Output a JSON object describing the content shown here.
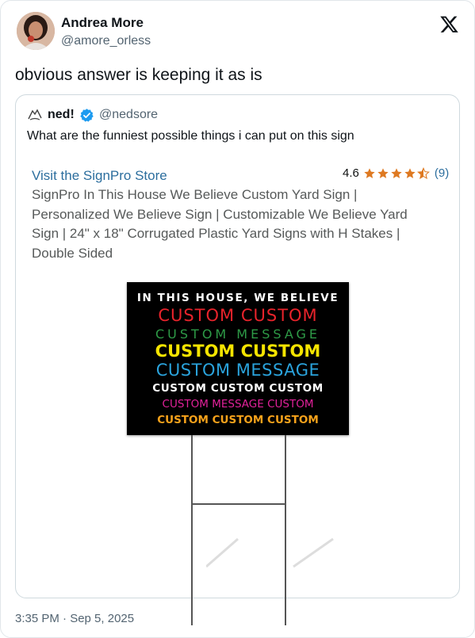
{
  "author": {
    "name": "Andrea More",
    "handle": "@amore_orless",
    "avatar_icon": "avatar-photo"
  },
  "platform_icon": "x-logo-icon",
  "tweet": {
    "text": "obvious answer is keeping it as is",
    "timestamp": "3:35 PM · Sep 5, 2025"
  },
  "quote": {
    "author_icon": "hands-icon",
    "name": "ned!",
    "verified_icon": "verified-badge-icon",
    "handle": "@nedsore",
    "text": "What are the funniest possible things i can put on this sign",
    "product": {
      "store_link": "Visit the SignPro Store",
      "rating": "4.6",
      "rating_stars": 4.6,
      "rating_count": "(9)",
      "title_lines": [
        "SignPro In This House We Believe Custom Yard Sign |",
        "Personalized We Believe Sign | Customizable We Believe Yard",
        "Sign | 24\" x 18\" Corrugated Plastic Yard Signs with H Stakes |",
        "Double Sided"
      ],
      "sign_lines": [
        {
          "text": "IN THIS HOUSE, WE BELIEVE",
          "color": "#ffffff"
        },
        {
          "text": "CUSTOM CUSTOM",
          "color": "#e8232b"
        },
        {
          "text": "CUSTOM MESSAGE",
          "color": "#2e9b47"
        },
        {
          "text": "CUSTOM CUSTOM",
          "color": "#f5e400"
        },
        {
          "text": "CUSTOM MESSAGE",
          "color": "#2aa3dc"
        },
        {
          "text": "CUSTOM CUSTOM CUSTOM",
          "color": "#ffffff"
        },
        {
          "text": "CUSTOM MESSAGE CUSTOM",
          "color": "#e2219a"
        },
        {
          "text": "CUSTOM CUSTOM CUSTOM",
          "color": "#f7a21b"
        }
      ]
    }
  },
  "colors": {
    "link": "#2c6e9e",
    "star": "#de7921",
    "verified": "#1d9bf0",
    "muted": "#536471"
  }
}
